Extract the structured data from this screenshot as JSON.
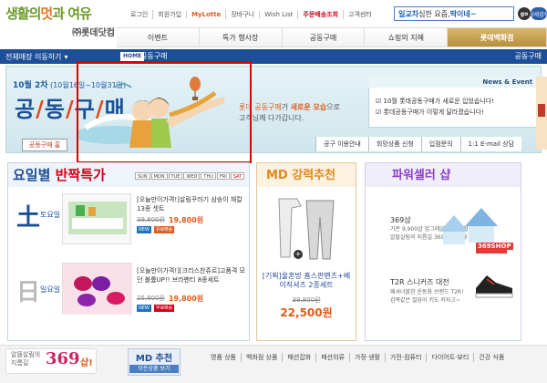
{
  "header": {
    "logo_line1_a": "생활의",
    "logo_line1_b": "멋",
    "logo_line1_c": "과 여유",
    "logo_line2": "㈜롯데닷컴",
    "util_links": [
      "로그인",
      "회원가입",
      "MyLotte",
      "장바구니",
      "Wish List",
      "주문배송조회",
      "고객센터"
    ],
    "search_value_a": "일교차",
    "search_value_b": " 심한 요즘, ",
    "search_value_c": "딱이네~",
    "go_label": "go",
    "advanced_search": "상세검색",
    "nav": [
      "이벤트",
      "특가 행사장",
      "공동구매",
      "쇼핑의 지혜",
      "롯데백화점"
    ]
  },
  "bluebar": {
    "category_dropdown": "전체매장 이동하기",
    "home_tag": "HOME",
    "breadcrumb": "공동구매",
    "right_label": "공동구매"
  },
  "hero": {
    "date_bold": "10월 2차",
    "date_range": "(10월16일~10월31일)",
    "title_chars": [
      "공",
      "동",
      "구",
      "매"
    ],
    "message_a": "롯데",
    "message_b": "공동구매",
    "message_c": "가 ",
    "message_d": "새로운 모습",
    "message_e": "으로",
    "message_f": "고객님께 다가갑니다.",
    "news_header": "News & Event",
    "news": [
      "10월 롯데공동구매가 새로운 입었습니다!",
      "롯데공동구매가 이렇게 달라졌습니다!"
    ],
    "main_button": "공동구매 홈",
    "sublinks": [
      "공구 이용안내",
      "희망상품 신청",
      "입점문의",
      "1:1 E-mail 상담"
    ]
  },
  "panel_daily": {
    "title_a": "요일별 ",
    "title_b": "반짝특가",
    "days": [
      "SUN",
      "MON",
      "TUE",
      "WED",
      "THU",
      "FRI",
      "SAT"
    ],
    "items": [
      {
        "day_big": "土",
        "day_small": "토요일",
        "name": "[오늘만이가격!]살림꾸러기 삼숭이 채칼13종 셋트",
        "old": "39,800원",
        "price": "19,800원",
        "badge_new": "NEW",
        "badge_ship": "유료배송"
      },
      {
        "day_big": "日",
        "day_small": "일요일",
        "name": "[오늘만이가격!][크리스찬쥬르]고품격 모던 볼륨UP!! 브라팬티 8종세트",
        "old": "25,800원",
        "price": "19,800원",
        "badge_new": "NEW",
        "badge_ship": "무료배송"
      }
    ]
  },
  "panel_md": {
    "title": "MD 강력추천",
    "product_name": "[기획]울혼방 홈스판팬츠+베이직셔츠 2종세트",
    "old_price": "39,800원",
    "price": "22,500원"
  },
  "panel_power": {
    "title": "파워셀러 샵",
    "shop1_name": "369샵",
    "shop1_desc": [
      "기존 9,900샵 업그레이드 특가 할인",
      "알뜰살림의 지름길 369샵~ 투!투!투!"
    ],
    "shop1_logo": "369SHOP",
    "shop2_name": "T2R 스니커즈 대전",
    "shop2_desc": [
      "패셔너블한 운동화 브랜드 T2R!",
      "감쪽같은 깔끔이 키도 커지고~"
    ]
  },
  "bottom": {
    "ad_small": [
      "알뜰살림의",
      "지름길"
    ],
    "ad_num": "369",
    "ad_tail": "샵!",
    "md_title": "MD 추천",
    "md_sub": "모든상품 보기",
    "categories": [
      "명품 상품",
      "백화점 상품",
      "패션잡화",
      "패션의류",
      "가정·생활",
      "가전·컴퓨터",
      "다이어트·뷰티",
      "건강 식품"
    ]
  },
  "colors": {
    "brand_blue": "#1c4f97",
    "accent_orange": "#e05b1c",
    "highlight_red": "#e00000"
  }
}
